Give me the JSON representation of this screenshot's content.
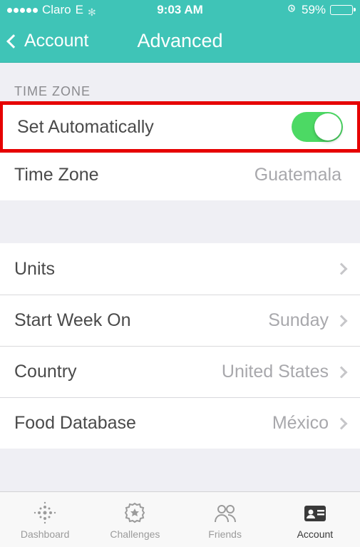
{
  "status": {
    "carrier": "Claro",
    "network": "E",
    "time": "9:03 AM",
    "battery_pct": "59%"
  },
  "nav": {
    "back_label": "Account",
    "title": "Advanced"
  },
  "section_timezone_header": "TIME ZONE",
  "rows": {
    "set_auto": {
      "label": "Set Automatically",
      "on": true
    },
    "timezone": {
      "label": "Time Zone",
      "value": "Guatemala"
    },
    "units": {
      "label": "Units"
    },
    "start_week": {
      "label": "Start Week On",
      "value": "Sunday"
    },
    "country": {
      "label": "Country",
      "value": "United States"
    },
    "food_db": {
      "label": "Food Database",
      "value": "México"
    }
  },
  "tabs": {
    "dashboard": "Dashboard",
    "challenges": "Challenges",
    "friends": "Friends",
    "account": "Account"
  }
}
